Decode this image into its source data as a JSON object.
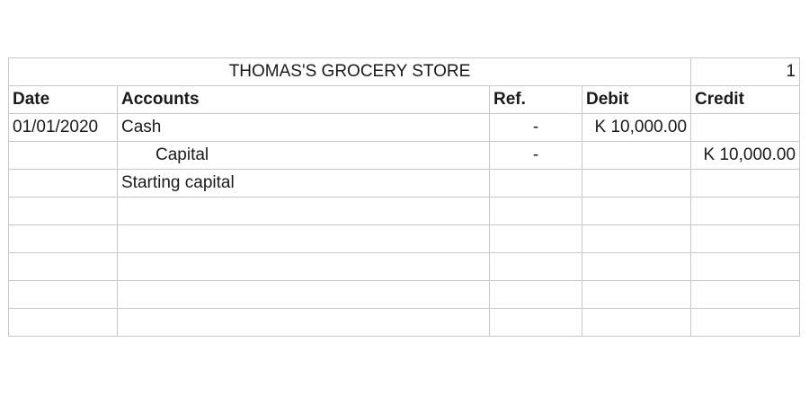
{
  "journal": {
    "title": "THOMAS'S GROCERY STORE",
    "page_number": "1",
    "headers": {
      "date": "Date",
      "accounts": "Accounts",
      "ref": "Ref.",
      "debit": "Debit",
      "credit": "Credit"
    },
    "entries": [
      {
        "date": "01/01/2020",
        "account": "Cash",
        "ref": "-",
        "debit": "K 10,000.00",
        "credit": ""
      },
      {
        "date": "",
        "account": "Capital",
        "ref": "-",
        "debit": "",
        "credit": "K 10,000.00"
      },
      {
        "date": "",
        "account": "Starting capital",
        "ref": "",
        "debit": "",
        "credit": ""
      }
    ]
  }
}
